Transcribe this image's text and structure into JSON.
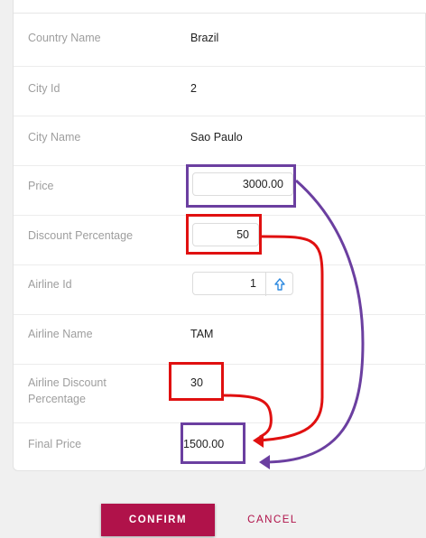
{
  "form": {
    "country_name": {
      "label": "Country Name",
      "value": "Brazil"
    },
    "city_id": {
      "label": "City Id",
      "value": "2"
    },
    "city_name": {
      "label": "City Name",
      "value": "Sao Paulo"
    },
    "price": {
      "label": "Price",
      "value": "3000.00"
    },
    "discount_percentage": {
      "label": "Discount Percentage",
      "value": "50"
    },
    "airline_id": {
      "label": "Airline Id",
      "value": "1",
      "stepper_icon": "arrow-up-icon"
    },
    "airline_name": {
      "label": "Airline Name",
      "value": "TAM"
    },
    "airline_discount_percentage": {
      "label_line1": "Airline Discount",
      "label_line2": "Percentage",
      "value": "30"
    },
    "final_price": {
      "label": "Final Price",
      "value": "1500.00"
    }
  },
  "actions": {
    "confirm_label": "CONFIRM",
    "cancel_label": "CANCEL"
  },
  "colors": {
    "accent": "#b0124a",
    "highlight_purple": "#6b3fa0",
    "highlight_red": "#e01010",
    "label_gray": "#9e9e9e",
    "stepper_blue": "#2f8ae0"
  }
}
